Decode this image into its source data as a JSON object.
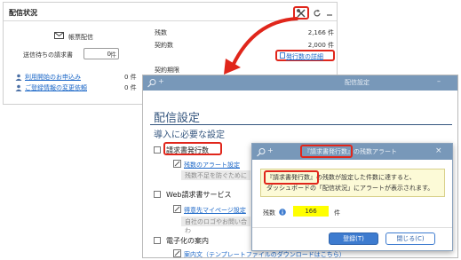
{
  "widget": {
    "title": "配信状況",
    "mail_label": "帳票配信",
    "pending_label": "送信待ちの請求書",
    "pending_value": "0",
    "pending_unit": "件",
    "links": [
      {
        "label": "利用開始のお申込み",
        "count": "0 件"
      },
      {
        "label": "ご登録情報の変更依頼",
        "count": "0 件"
      }
    ],
    "stats": [
      {
        "label": "残数",
        "value": "2,166 件"
      },
      {
        "label": "契約数",
        "value": "2,000 件"
      }
    ],
    "detail_link": "発行数の詳細",
    "period_label": "契約期限"
  },
  "settings": {
    "window_title": "配信設定",
    "heading": "配信設定",
    "subheading": "導入に必要な設定",
    "sections": [
      {
        "label": "請求書発行数",
        "sub_link": "残数のアラート設定",
        "hint": "残数不足を防ぐために"
      },
      {
        "label": "Web請求書サービス",
        "sub_link": "得意先マイページ設定",
        "hint": "自社のロゴやお問い合わ"
      },
      {
        "label": "電子化の案内",
        "sub_link": "案内文（テンプレートファイルのダウンロードはこちら）",
        "hint": ""
      }
    ]
  },
  "dialog": {
    "title_highlight": "『請求書発行数』",
    "title_rest": "の残数アラート",
    "msg_highlight": "『請求書発行数』",
    "msg_line1_rest": "の残数が設定した件数に達すると、",
    "msg_line2": "ダッシュボードの「配信状況」にアラートが表示されます。",
    "count_label": "残数",
    "count_value": "166",
    "count_unit": "件",
    "register_button": "登録(T)",
    "close_button": "閉じる(C)"
  },
  "colors": {
    "highlight": "#e0261b",
    "title_bar": "#7898b9",
    "heading": "#34557e",
    "link": "#1a66c7",
    "primary_button": "#3d7bcf",
    "count_field": "#ffff00",
    "message_bg": "#fcfad7"
  },
  "icons": [
    "mail-icon",
    "search-icon",
    "settings-icon",
    "refresh-icon",
    "minimize-icon",
    "close-icon",
    "user-icon",
    "info-icon",
    "edit-icon",
    "checkbox"
  ]
}
